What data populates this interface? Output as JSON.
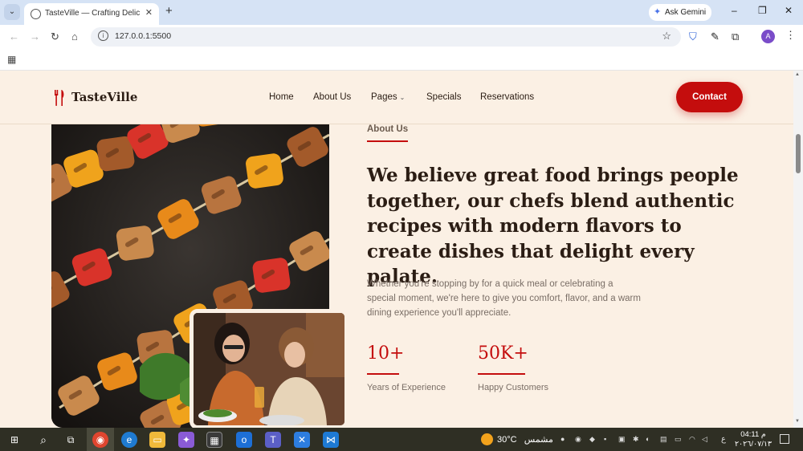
{
  "browser": {
    "tab_title": "TasteVille — Crafting Delicious",
    "tab_close": "✕",
    "new_tab": "+",
    "ask_gemini": "Ask Gemini",
    "url": "127.0.0.1:5500",
    "profile_initial": "A",
    "minimize": "–",
    "restore": "❐",
    "close": "✕"
  },
  "site": {
    "brand": "TasteVille",
    "nav": [
      "Home",
      "About Us",
      "Pages",
      "Specials",
      "Reservations"
    ],
    "contact_label": "Contact"
  },
  "about": {
    "label": "About Us",
    "headline": "We believe great food brings people together, our chefs blend authentic recipes with modern flavors to create dishes that delight every palate.",
    "paragraph": "Whether you're stopping by for a quick meal or celebrating a special moment, we're here to give you comfort, flavor, and a warm dining experience you'll appreciate.",
    "stats": [
      {
        "value": "10+",
        "label": "Years of Experience"
      },
      {
        "value": "50K+",
        "label": "Happy Customers"
      }
    ]
  },
  "taskbar": {
    "temperature": "30°C",
    "weather_text": "مشمس",
    "time": "04:11 م",
    "date": "٢٠٢٦/٠٧/١٣",
    "lang": "ع"
  },
  "colors": {
    "accent": "#c40d0d",
    "page_bg": "#fbf0e4",
    "heading": "#2b1d14"
  }
}
